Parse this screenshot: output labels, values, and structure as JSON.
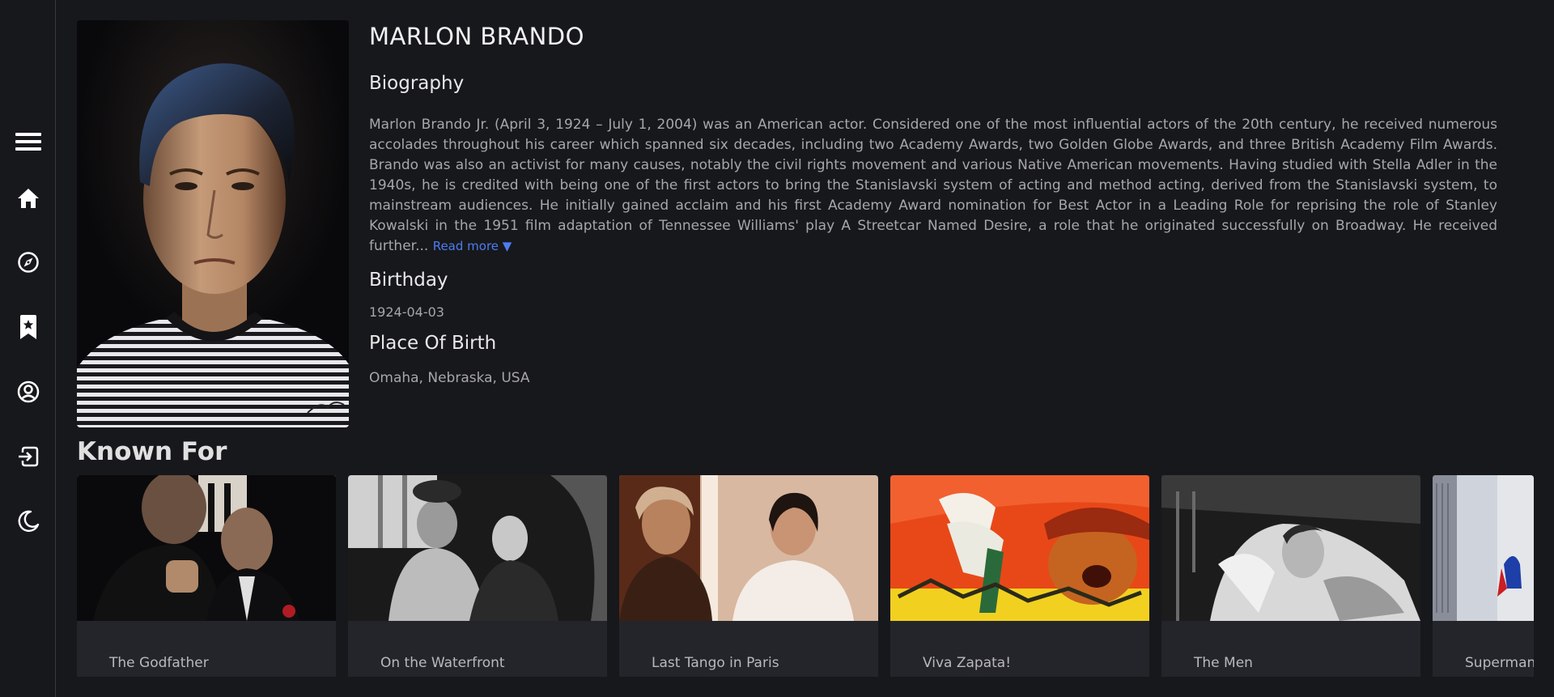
{
  "sidebar": {
    "items": [
      {
        "icon": "menu-icon"
      },
      {
        "icon": "home-icon"
      },
      {
        "icon": "compass-icon"
      },
      {
        "icon": "bookmark-icon"
      },
      {
        "icon": "user-icon"
      },
      {
        "icon": "sign-in-icon"
      },
      {
        "icon": "moon-icon"
      }
    ]
  },
  "person": {
    "name": "MARLON BRANDO",
    "biography_heading": "Biography",
    "biography": "Marlon Brando Jr. (April 3, 1924 – July 1, 2004) was an American actor. Considered one of the most influential actors of the 20th century, he received numerous accolades throughout his career which spanned six decades, including two Academy Awards, two Golden Globe Awards, and three British Academy Film Awards. Brando was also an activist for many causes, notably the civil rights movement and various Native American movements. Having studied with Stella Adler in the 1940s, he is credited with being one of the first actors to bring the Stanislavski system of acting and method acting, derived from the Stanislavski system, to mainstream audiences. He initially gained acclaim and his first Academy Award nomination for Best Actor in a Leading Role for reprising the role of Stanley Kowalski in the 1951 film adaptation of Tennessee Williams' play A Streetcar Named Desire, a role that he originated successfully on Broadway. He received further...",
    "read_more": "Read more ▼",
    "birthday_heading": "Birthday",
    "birthday": "1924-04-03",
    "place_of_birth_heading": "Place Of Birth",
    "place_of_birth": "Omaha, Nebraska, USA"
  },
  "known_for": {
    "title": "Known For",
    "movies": [
      {
        "title": "The Godfather"
      },
      {
        "title": "On the Waterfront"
      },
      {
        "title": "Last Tango in Paris"
      },
      {
        "title": "Viva Zapata!"
      },
      {
        "title": "The Men"
      },
      {
        "title": "Superman"
      }
    ]
  },
  "colors": {
    "background": "#17181c",
    "card": "#24252a",
    "link": "#4d7cf0",
    "muted_text": "#a6a6ab"
  }
}
